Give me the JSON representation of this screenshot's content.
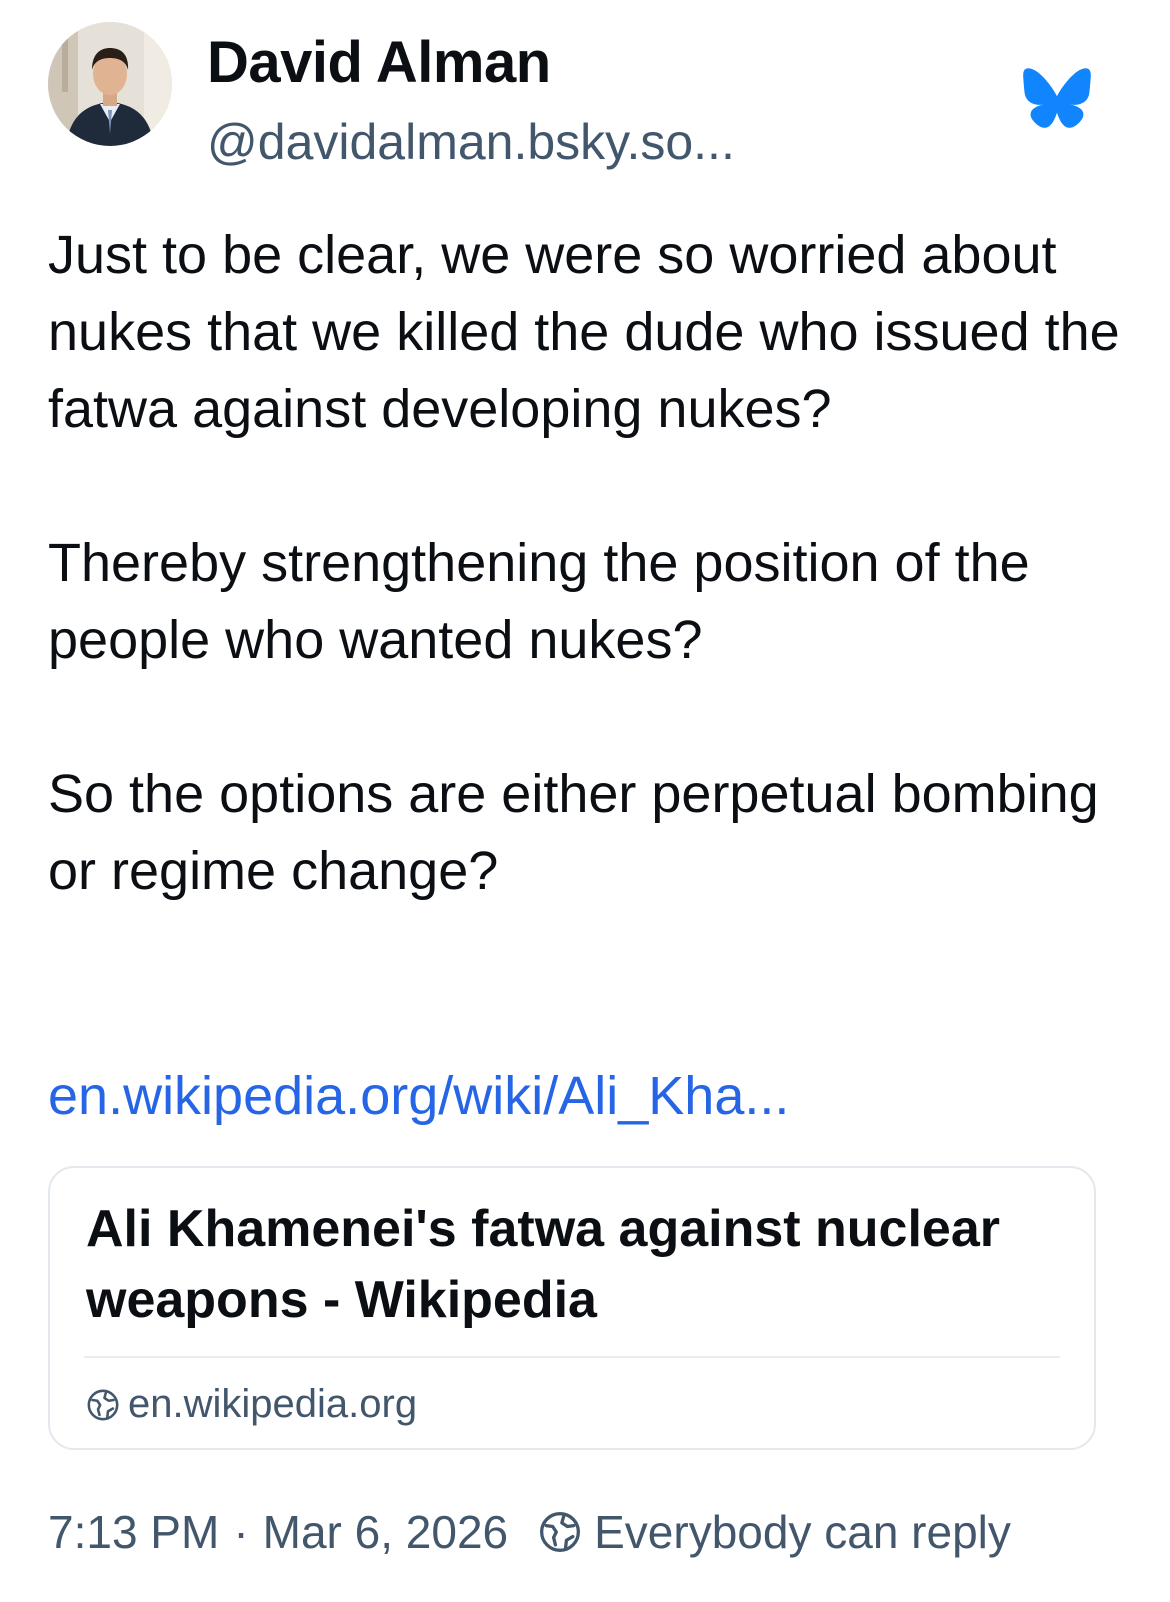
{
  "author": {
    "display_name": "David Alman",
    "handle": "@davidalman.bsky.so..."
  },
  "post": {
    "paragraphs": [
      "Just to be clear, we were so worried about nukes that we killed the dude who issued the fatwa against developing nukes?",
      "Thereby strengthening the position of the people who wanted nukes?",
      "So the options are either perpetual bombing or regime change?"
    ],
    "link_text": "en.wikipedia.org/wiki/Ali_Kha..."
  },
  "link_card": {
    "title": "Ali Khamenei's fatwa against nuclear weapons - Wikipedia",
    "domain": "en.wikipedia.org",
    "domain_icon": "globe-icon"
  },
  "footer": {
    "time": "7:13 PM",
    "separator": "·",
    "date": "Mar 6, 2026",
    "reply_icon": "globe-icon",
    "reply_setting": "Everybody can reply"
  },
  "colors": {
    "text": "#0b0f14",
    "secondary": "#42576c",
    "link": "#2565e6",
    "brand": "#1185fe",
    "card_border": "#e3e8ee"
  }
}
